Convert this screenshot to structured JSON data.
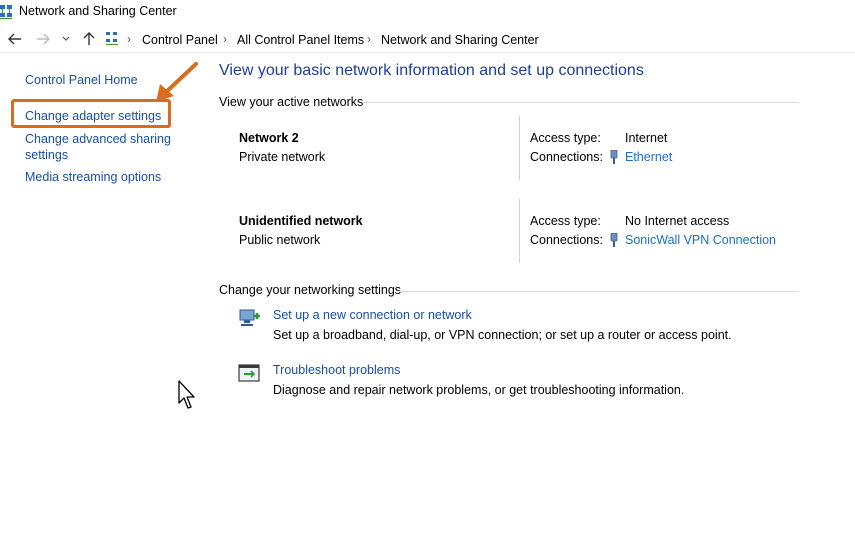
{
  "window": {
    "title": "Network and Sharing Center",
    "icon": "network-center-icon"
  },
  "address_bar": {
    "back_icon": "back-arrow-icon",
    "forward_icon": "forward-arrow-icon",
    "recent_icon": "chevron-down-icon",
    "up_icon": "up-arrow-icon",
    "breadcrumb": [
      "Control Panel",
      "All Control Panel Items",
      "Network and Sharing Center"
    ]
  },
  "sidebar": {
    "items": [
      {
        "label": "Control Panel Home"
      },
      {
        "label": "Change adapter settings",
        "highlighted": true
      },
      {
        "label": "Change advanced sharing settings"
      },
      {
        "label": "Media streaming options"
      }
    ],
    "highlight_color": "#d86d1e"
  },
  "main": {
    "title": "View your basic network information and set up connections",
    "active_networks_header": "View your active networks",
    "networks": [
      {
        "name": "Network 2",
        "category": "Private network",
        "access_type_label": "Access type:",
        "access_type": "Internet",
        "connections_label": "Connections:",
        "connection": "Ethernet"
      },
      {
        "name": "Unidentified network",
        "category": "Public network",
        "access_type_label": "Access type:",
        "access_type": "No Internet access",
        "connections_label": "Connections:",
        "connection": "SonicWall VPN Connection"
      }
    ],
    "settings_header": "Change your networking settings",
    "tasks": [
      {
        "link": "Set up a new connection or network",
        "description": "Set up a broadband, dial-up, or VPN connection; or set up a router or access point.",
        "icon": "new-connection-icon"
      },
      {
        "link": "Troubleshoot problems",
        "description": "Diagnose and repair network problems, or get troubleshooting information.",
        "icon": "troubleshoot-icon"
      }
    ]
  },
  "colors": {
    "link": "#1a6fc4",
    "title": "#1d3f99",
    "annotation": "#d86d1e"
  }
}
